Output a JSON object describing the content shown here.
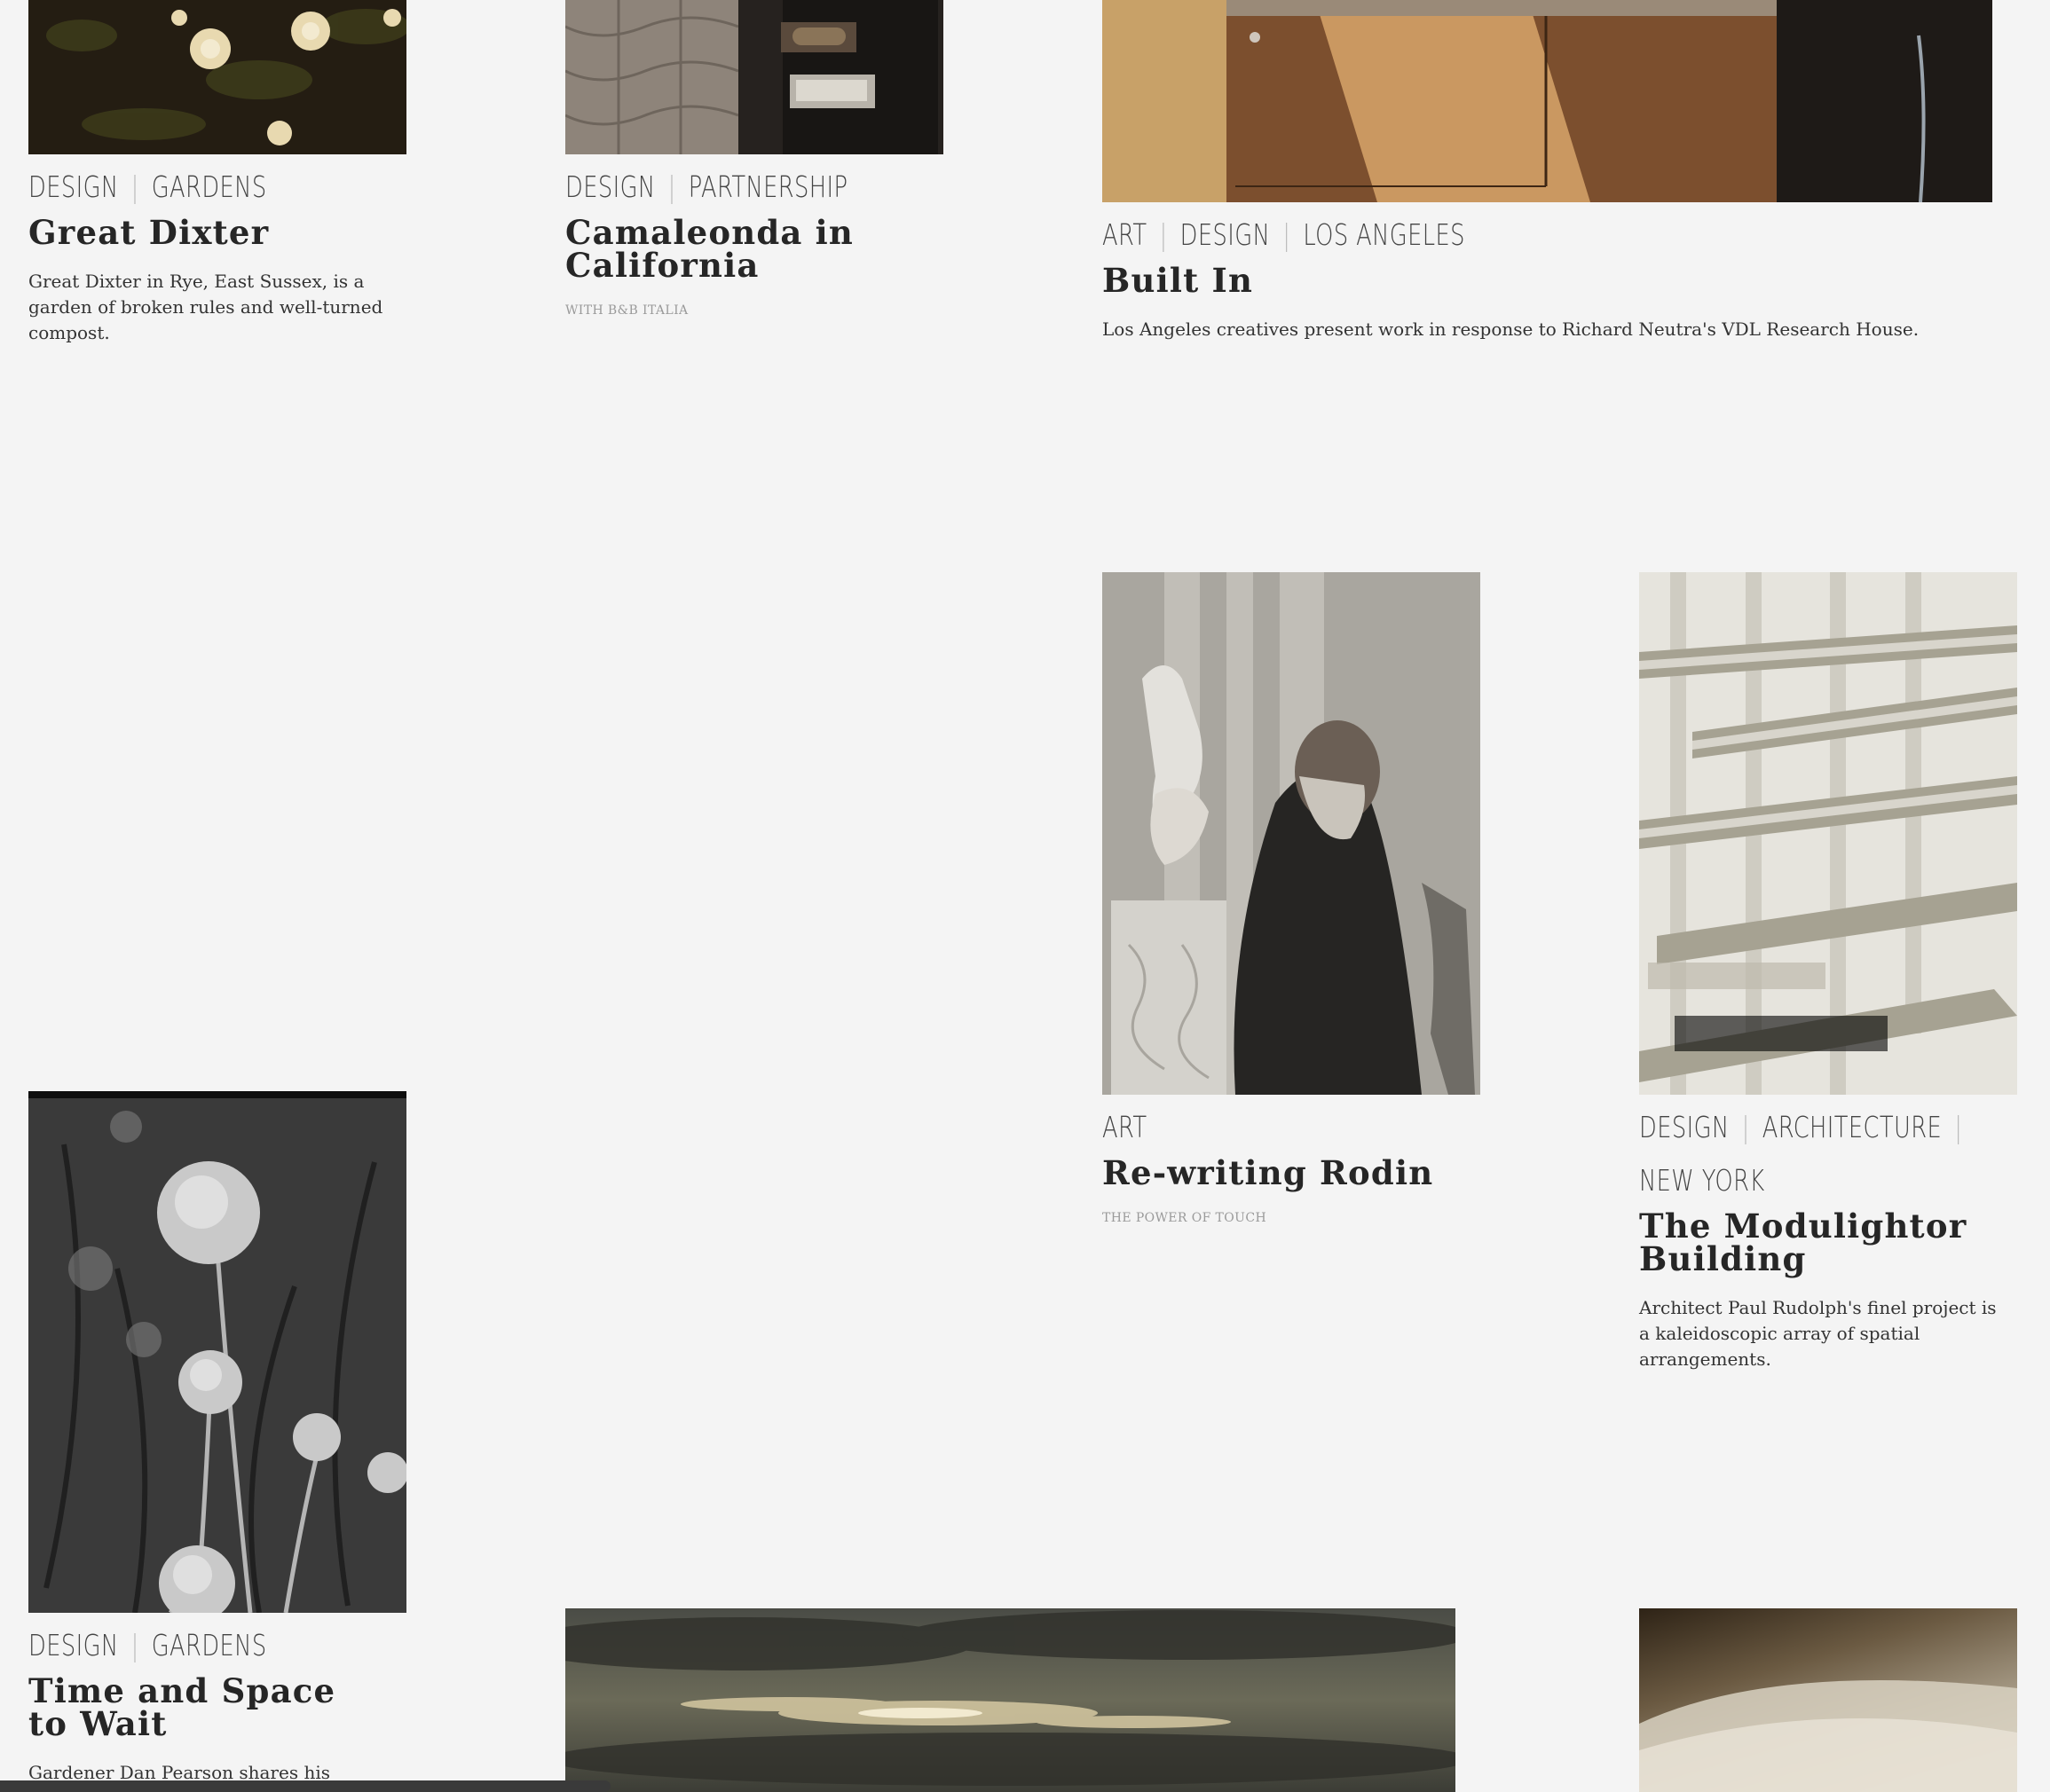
{
  "articles": [
    {
      "id": "great-dixter",
      "categories": [
        "DESIGN",
        "GARDENS"
      ],
      "title": "Great Dixter",
      "description": "Great Dixter in Rye, East Sussex, is a garden of broken rules and well-turned compost."
    },
    {
      "id": "camaleonda",
      "categories": [
        "DESIGN",
        "PARTNERSHIP"
      ],
      "title": "Camaleonda in California",
      "subtitle": "WITH B&B ITALIA"
    },
    {
      "id": "built-in",
      "categories": [
        "ART",
        "DESIGN",
        "LOS ANGELES"
      ],
      "title": "Built In",
      "description": "Los Angeles creatives present work in response to Richard Neutra's VDL Research House."
    },
    {
      "id": "rewriting-rodin",
      "categories": [
        "ART"
      ],
      "title": "Re-writing Rodin",
      "subtitle": "THE POWER OF TOUCH"
    },
    {
      "id": "modulightor",
      "categories": [
        "DESIGN",
        "ARCHITECTURE",
        "NEW YORK"
      ],
      "title": "The Modulightor Building",
      "description": "Architect Paul Rudolph's finel project is a kaleidoscopic array of spatial arrangements."
    },
    {
      "id": "time-and-space",
      "categories": [
        "DESIGN",
        "GARDENS"
      ],
      "title": "Time and Space to Wait",
      "description": "Gardener Dan Pearson shares his"
    }
  ],
  "images": {
    "flowers": "white-roses-photo",
    "sofa": "camaleonda-sofa-photo",
    "cabinet": "wood-cabinet-photo",
    "rodin": "rodin-portrait-photo",
    "shelves": "modulightor-stairs-photo",
    "alliums": "allium-seedheads-photo",
    "clouds": "cloudy-sky-photo",
    "plaster": "plaster-wall-photo"
  },
  "colors": {
    "background": "#f4f4f4",
    "text": "#262626",
    "muted": "#9a9a9a"
  }
}
